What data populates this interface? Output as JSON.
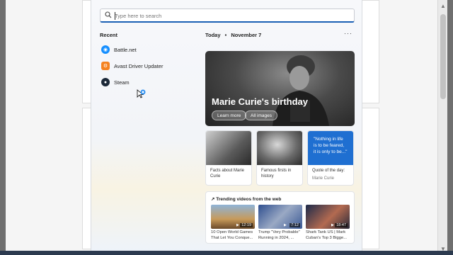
{
  "search": {
    "placeholder": "Type here to search"
  },
  "recent": {
    "title": "Recent",
    "apps": [
      {
        "label": "Battle.net",
        "icon": "battlenet-icon",
        "color": "#148eff"
      },
      {
        "label": "Avast Driver Updater",
        "icon": "avast-driver-icon",
        "color": "#f58220"
      },
      {
        "label": "Steam",
        "icon": "steam-icon",
        "color": "#1b2838"
      }
    ]
  },
  "feed": {
    "day": "Today",
    "separator": "•",
    "date": "November 7",
    "more": "···",
    "hero": {
      "title": "Marie Curie's birthday",
      "learn_more": "Learn more",
      "all_images": "All images"
    },
    "cards": [
      {
        "caption": "Facts about Marie Curie"
      },
      {
        "caption": "Famous firsts in history"
      },
      {
        "quote": "\"Nothing in life is to be feared, it is only to be...\"",
        "caption": "Quote of the day:",
        "author": "Marie Curie"
      }
    ],
    "trending": {
      "title": "Trending videos from the web",
      "videos": [
        {
          "duration": "12:19",
          "caption": "10 Open World Games That Let You Conque..."
        },
        {
          "duration": "7:12",
          "caption": "Trump \"Very Probable\" Running in 2024, ..."
        },
        {
          "duration": "18:47",
          "caption": "Shark Tank US | Mark Cuban's Top 3 Bigge..."
        }
      ]
    }
  }
}
